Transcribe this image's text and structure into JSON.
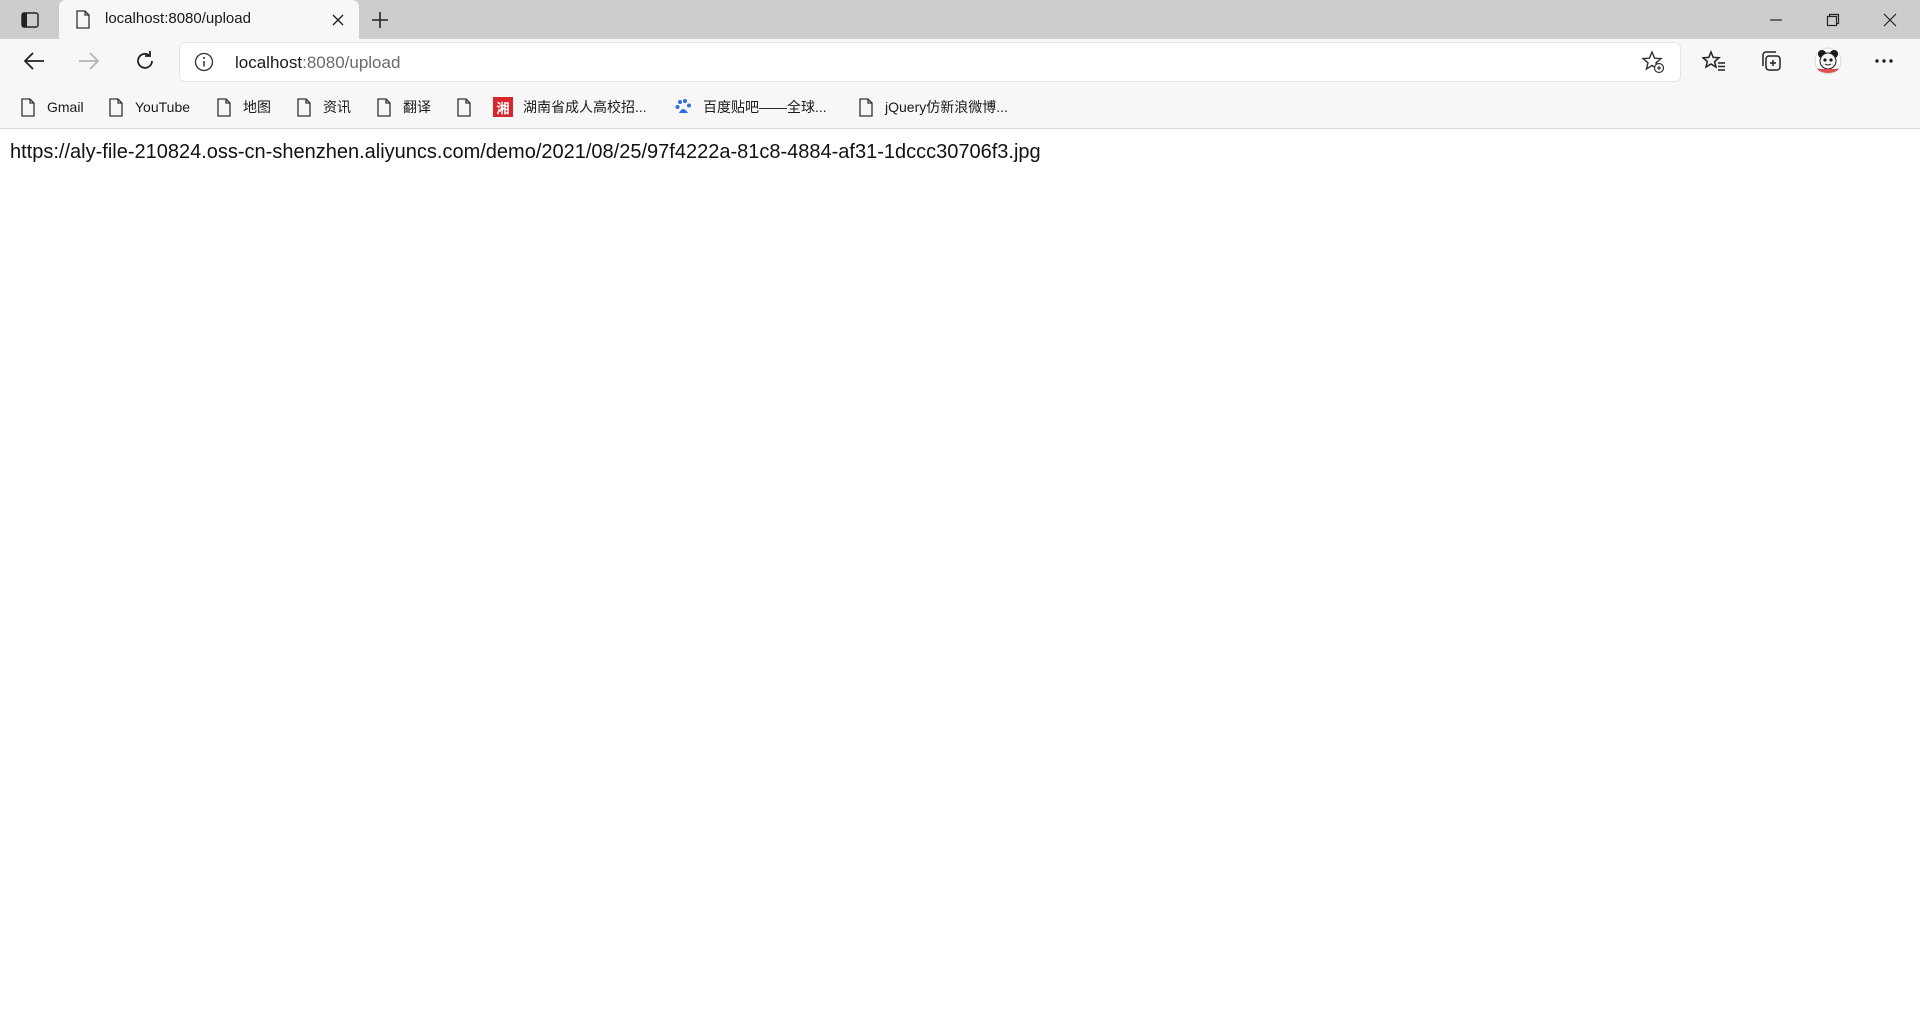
{
  "tab": {
    "title": "localhost:8080/upload"
  },
  "address": {
    "host": "localhost",
    "rest": ":8080/upload"
  },
  "bookmarks": [
    {
      "label": "Gmail",
      "icon": "page-icon"
    },
    {
      "label": "YouTube",
      "icon": "page-icon"
    },
    {
      "label": "地图",
      "icon": "page-icon"
    },
    {
      "label": "资讯",
      "icon": "page-icon"
    },
    {
      "label": "翻译",
      "icon": "page-icon"
    },
    {
      "label": "",
      "icon": "page-icon"
    },
    {
      "label": "湖南省成人高校招...",
      "icon": "xiang-logo-icon",
      "icon_text": "湘"
    },
    {
      "label": "百度贴吧——全球...",
      "icon": "baidu-paw-icon"
    },
    {
      "label": "jQuery仿新浪微博...",
      "icon": "page-icon"
    }
  ],
  "page": {
    "text": "https://aly-file-210824.oss-cn-shenzhen.aliyuncs.com/demo/2021/08/25/97f4222a-81c8-4884-af31-1dccc30706f3.jpg"
  },
  "colors": {
    "tabstrip": "#cdcdcd",
    "toolbar": "#f7f7f7",
    "xiang_logo": "#d7262b",
    "baidu_paw": "#2f6fe4"
  }
}
